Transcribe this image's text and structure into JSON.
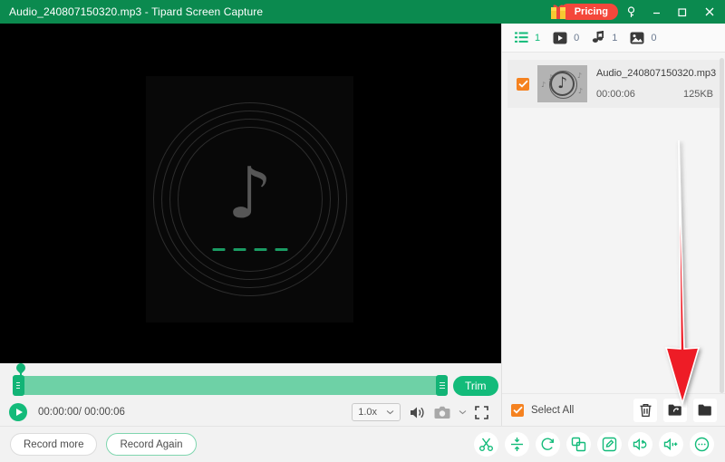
{
  "titlebar": {
    "file_name": "Audio_240807150320.mp3",
    "separator": "-",
    "app_name": "Tipard Screen Capture",
    "title_full": "Audio_240807150320.mp3  -  Tipard Screen Capture",
    "pricing_label": "Pricing",
    "gift_icon": "gift-icon",
    "help_icon": "key-help-icon",
    "minimize_icon": "minimize-icon",
    "maximize_icon": "maximize-icon",
    "close_icon": "close-icon",
    "bg_color": "#0b8a4f",
    "pricing_color": "#f4473b"
  },
  "preview": {
    "background": "#000000",
    "visual_icon": "music-note-icon",
    "note_glyph": "♪",
    "dash_count": 4,
    "dash_color": "#1a9b63",
    "ring_count": 4
  },
  "timeline": {
    "trim_label": "Trim",
    "track_color": "#6ed1a6",
    "handle_color": "#12b476",
    "left_handle": "trim-handle-left",
    "right_handle": "trim-handle-right",
    "playhead": "playhead-marker"
  },
  "playback": {
    "play_icon": "play-icon",
    "current_time": "00:00:00",
    "total_time": "00:00:06",
    "time_display": "00:00:00/ 00:00:06",
    "speed_value": "1.0x",
    "speed_chevron": "chevron-down-icon",
    "volume_icon": "volume-icon",
    "camera_icon": "camera-icon",
    "camera_chevron": "chevron-down-icon",
    "fullscreen_icon": "fullscreen-icon"
  },
  "bottombar": {
    "record_more_label": "Record more",
    "record_again_label": "Record Again",
    "tools": [
      {
        "name": "trim-tool",
        "icon": "scissors-icon"
      },
      {
        "name": "compress-tool",
        "icon": "compress-icon"
      },
      {
        "name": "convert-tool",
        "icon": "rotate-convert-icon"
      },
      {
        "name": "merge-tool",
        "icon": "merge-squares-icon"
      },
      {
        "name": "edit-tool",
        "icon": "pencil-edit-icon"
      },
      {
        "name": "audio-effect-tool",
        "icon": "speaker-loop-icon"
      },
      {
        "name": "volume-tool",
        "icon": "speaker-plus-icon"
      },
      {
        "name": "more-tool",
        "icon": "more-dots-icon"
      }
    ],
    "tool_color": "#13bb7a"
  },
  "panel": {
    "tabs": [
      {
        "name": "tab-all",
        "icon": "list-icon",
        "count": "1",
        "active": true
      },
      {
        "name": "tab-video",
        "icon": "video-icon",
        "count": "0",
        "active": false
      },
      {
        "name": "tab-audio",
        "icon": "music-icon",
        "count": "1",
        "active": false
      },
      {
        "name": "tab-image",
        "icon": "image-icon",
        "count": "0",
        "active": false
      }
    ],
    "files": [
      {
        "checked": true,
        "thumb_icon": "audio-note-thumbnail",
        "name": "Audio_240807150320.mp3",
        "duration": "00:00:06",
        "size": "125KB"
      }
    ],
    "footer": {
      "select_all_label": "Select All",
      "select_all_checked": true,
      "actions": [
        {
          "name": "delete-button",
          "icon": "trash-icon"
        },
        {
          "name": "share-export-button",
          "icon": "folder-share-icon"
        },
        {
          "name": "open-folder-button",
          "icon": "folder-open-icon"
        }
      ]
    },
    "checkbox_color": "#f58220",
    "scrollbar": "vertical-scrollbar"
  },
  "annotation": {
    "arrow_icon": "red-down-arrow",
    "arrow_color": "#ee1c25",
    "points_to": "share-export-button"
  }
}
